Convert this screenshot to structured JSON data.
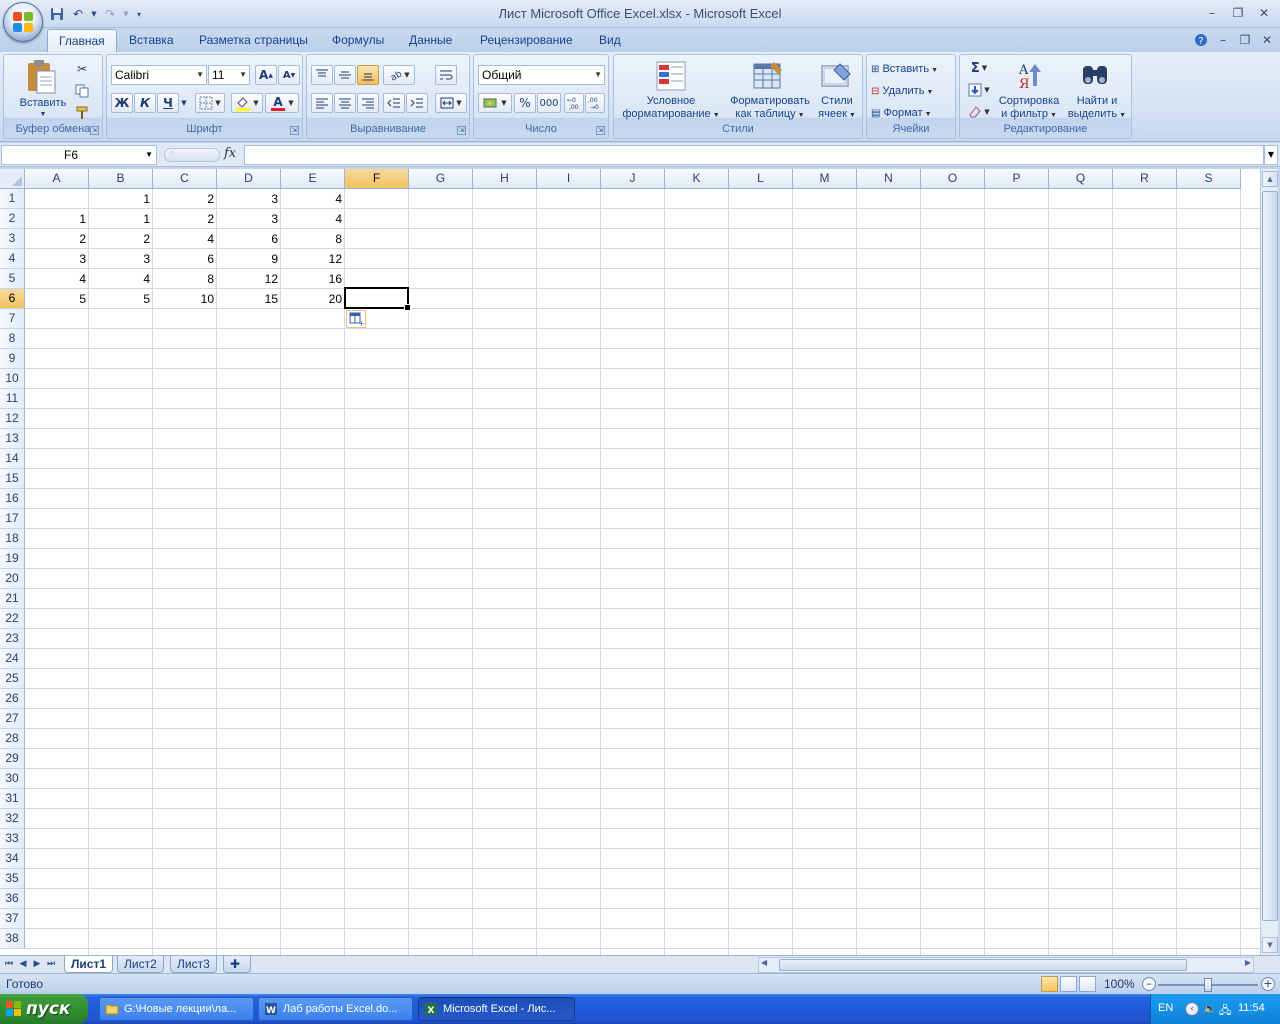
{
  "window": {
    "title": "Лист Microsoft Office Excel.xlsx - Microsoft Excel"
  },
  "ribbon_tabs": [
    {
      "label": "Главная",
      "active": true
    },
    {
      "label": "Вставка"
    },
    {
      "label": "Разметка страницы"
    },
    {
      "label": "Формулы"
    },
    {
      "label": "Данные"
    },
    {
      "label": "Рецензирование"
    },
    {
      "label": "Вид"
    }
  ],
  "ribbon": {
    "clipboard": {
      "label": "Буфер обмена",
      "paste": "Вставить"
    },
    "font": {
      "label": "Шрифт",
      "name": "Calibri",
      "size": "11",
      "bold": "Ж",
      "italic": "К",
      "underline": "Ч"
    },
    "alignment": {
      "label": "Выравнивание"
    },
    "number": {
      "label": "Число",
      "format": "Общий",
      "percent": "%",
      "thousands": "000"
    },
    "styles": {
      "label": "Стили",
      "conditional": [
        "Условное",
        "форматирование"
      ],
      "format_table": [
        "Форматировать",
        "как таблицу"
      ],
      "cell_styles": [
        "Стили",
        "ячеек"
      ]
    },
    "cells": {
      "label": "Ячейки",
      "insert": "Вставить",
      "delete": "Удалить",
      "format": "Формат"
    },
    "editing": {
      "label": "Редактирование",
      "sigma": "Σ",
      "sort": [
        "Сортировка",
        "и фильтр"
      ],
      "find": [
        "Найти и",
        "выделить"
      ]
    }
  },
  "formula_bar": {
    "name_box": "F6",
    "fx": "fx",
    "value": ""
  },
  "grid": {
    "columns": [
      "A",
      "B",
      "C",
      "D",
      "E",
      "F",
      "G",
      "H",
      "I",
      "J",
      "K",
      "L",
      "M",
      "N",
      "O",
      "P",
      "Q",
      "R",
      "S"
    ],
    "selected_column": "F",
    "row_count": 38,
    "selected_row": 6,
    "cells": [
      [
        "",
        "1",
        "2",
        "3",
        "4"
      ],
      [
        "1",
        "1",
        "2",
        "3",
        "4"
      ],
      [
        "2",
        "2",
        "4",
        "6",
        "8"
      ],
      [
        "3",
        "3",
        "6",
        "9",
        "12"
      ],
      [
        "4",
        "4",
        "8",
        "12",
        "16"
      ],
      [
        "5",
        "5",
        "10",
        "15",
        "20"
      ]
    ]
  },
  "sheet_tabs": [
    {
      "label": "Лист1",
      "active": true
    },
    {
      "label": "Лист2"
    },
    {
      "label": "Лист3"
    }
  ],
  "status": {
    "ready": "Готово",
    "zoom": "100%",
    "zoom_fraction": 0.5
  },
  "taskbar": {
    "start": "пуск",
    "tasks": [
      {
        "label": "G:\\Новые лекции\\ла..."
      },
      {
        "label": "Лаб работы Excel.do..."
      },
      {
        "label": "Microsoft Excel - Лис...",
        "active": true
      }
    ],
    "lang": "EN",
    "clock": "11:54"
  },
  "colors": {
    "accent": "#15428b",
    "selected_header": "#f1c15f",
    "taskbar": "#225ad8",
    "start": "#3c9a3c"
  }
}
